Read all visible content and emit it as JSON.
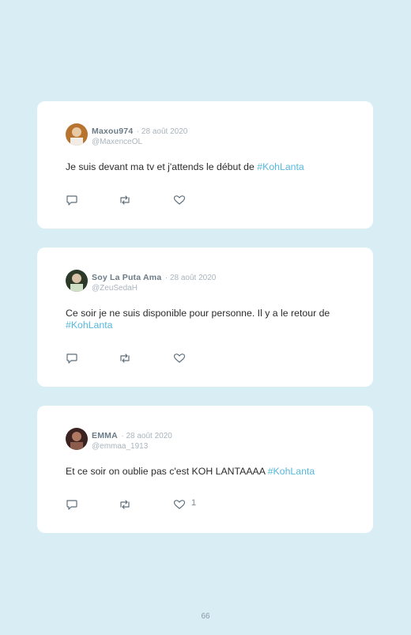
{
  "tweets": [
    {
      "name": "Maxou974",
      "date": "· 28 août 2020",
      "handle": "@MaxenceOL",
      "text": "Je suis devant ma tv et j'attends le début de ",
      "hashtag": "#KohLanta",
      "likes": "",
      "avatar_colors": [
        "#b8742f",
        "#e7d6c5"
      ]
    },
    {
      "name": "Soy La Puta Ama",
      "date": "· 28 août 2020",
      "handle": "@ZeuSedaH",
      "text": "Ce soir je ne suis disponible pour personne. Il y a le retour de ",
      "hashtag": "#KohLanta",
      "likes": "",
      "avatar_colors": [
        "#2d3a2a",
        "#cfe0c7"
      ]
    },
    {
      "name": "EMMA",
      "date": "· 28 août 2020",
      "handle": "@emmaa_1913",
      "text": "Et ce soir on oublie pas c'est KOH LANTAAAA ",
      "hashtag": "#KohLanta",
      "likes": "1",
      "avatar_colors": [
        "#3a2320",
        "#8c5b4c"
      ]
    }
  ],
  "icons": [
    "reply-icon",
    "retweet-icon",
    "like-icon"
  ],
  "page_number": "66"
}
